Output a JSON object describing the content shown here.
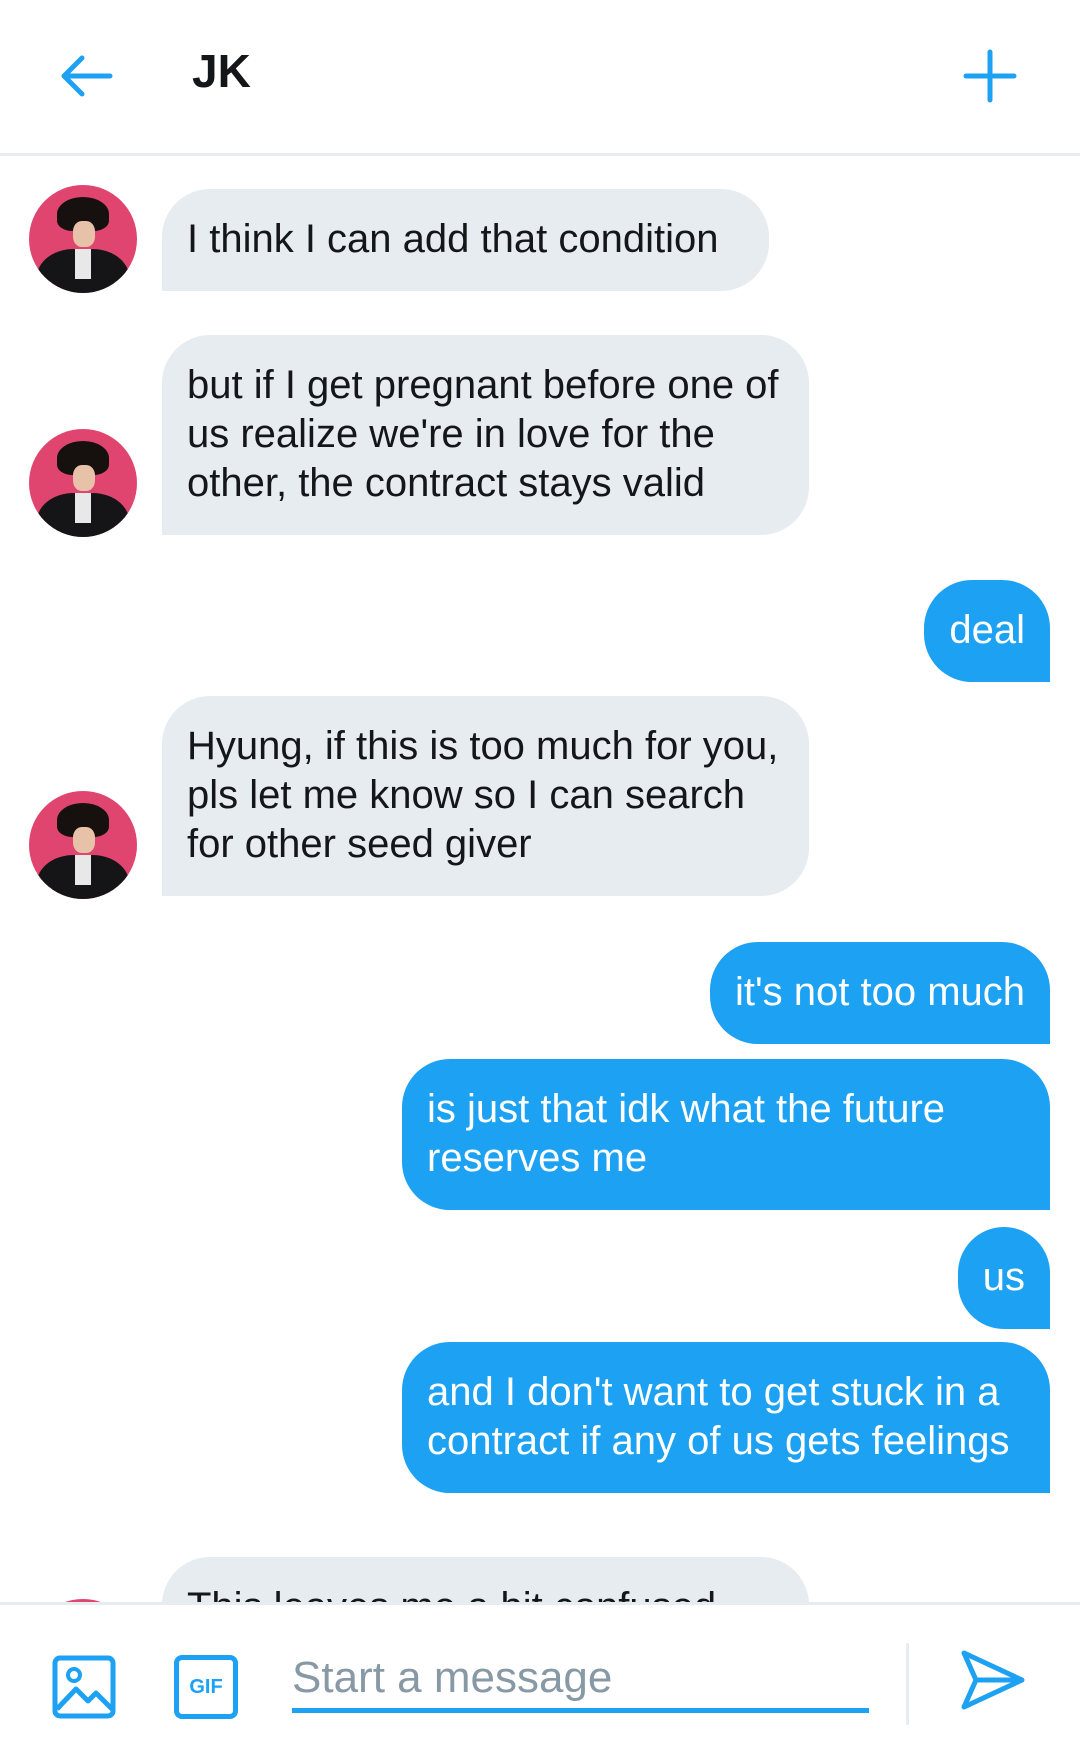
{
  "header": {
    "title": "JK",
    "back_icon": "arrow-left-icon",
    "add_icon": "plus-icon"
  },
  "messages": [
    {
      "side": "in",
      "text": "I think I can add that condition"
    },
    {
      "side": "in",
      "text": "but if I get pregnant before one of us realize we're in love for the other, the contract stays valid"
    },
    {
      "side": "out",
      "text": "deal"
    },
    {
      "side": "in",
      "text": "Hyung, if this is too much for you, pls let me know so I can search for other seed giver"
    },
    {
      "side": "out",
      "text": "it's not too much"
    },
    {
      "side": "out",
      "text": "is just that idk what the future reserves me"
    },
    {
      "side": "out",
      "text": "us"
    },
    {
      "side": "out",
      "text": "and I don't want to get stuck in a contract if any of us gets feelings"
    },
    {
      "side": "in",
      "text": "This leaves me a bit confused"
    }
  ],
  "composer": {
    "placeholder": "Start a message",
    "gif_label": "GIF",
    "image_icon": "image-icon",
    "send_icon": "send-icon"
  },
  "colors": {
    "accent": "#1da1f2",
    "incoming_bubble": "#e6ecf0",
    "avatar_bg": "#e0456f"
  }
}
